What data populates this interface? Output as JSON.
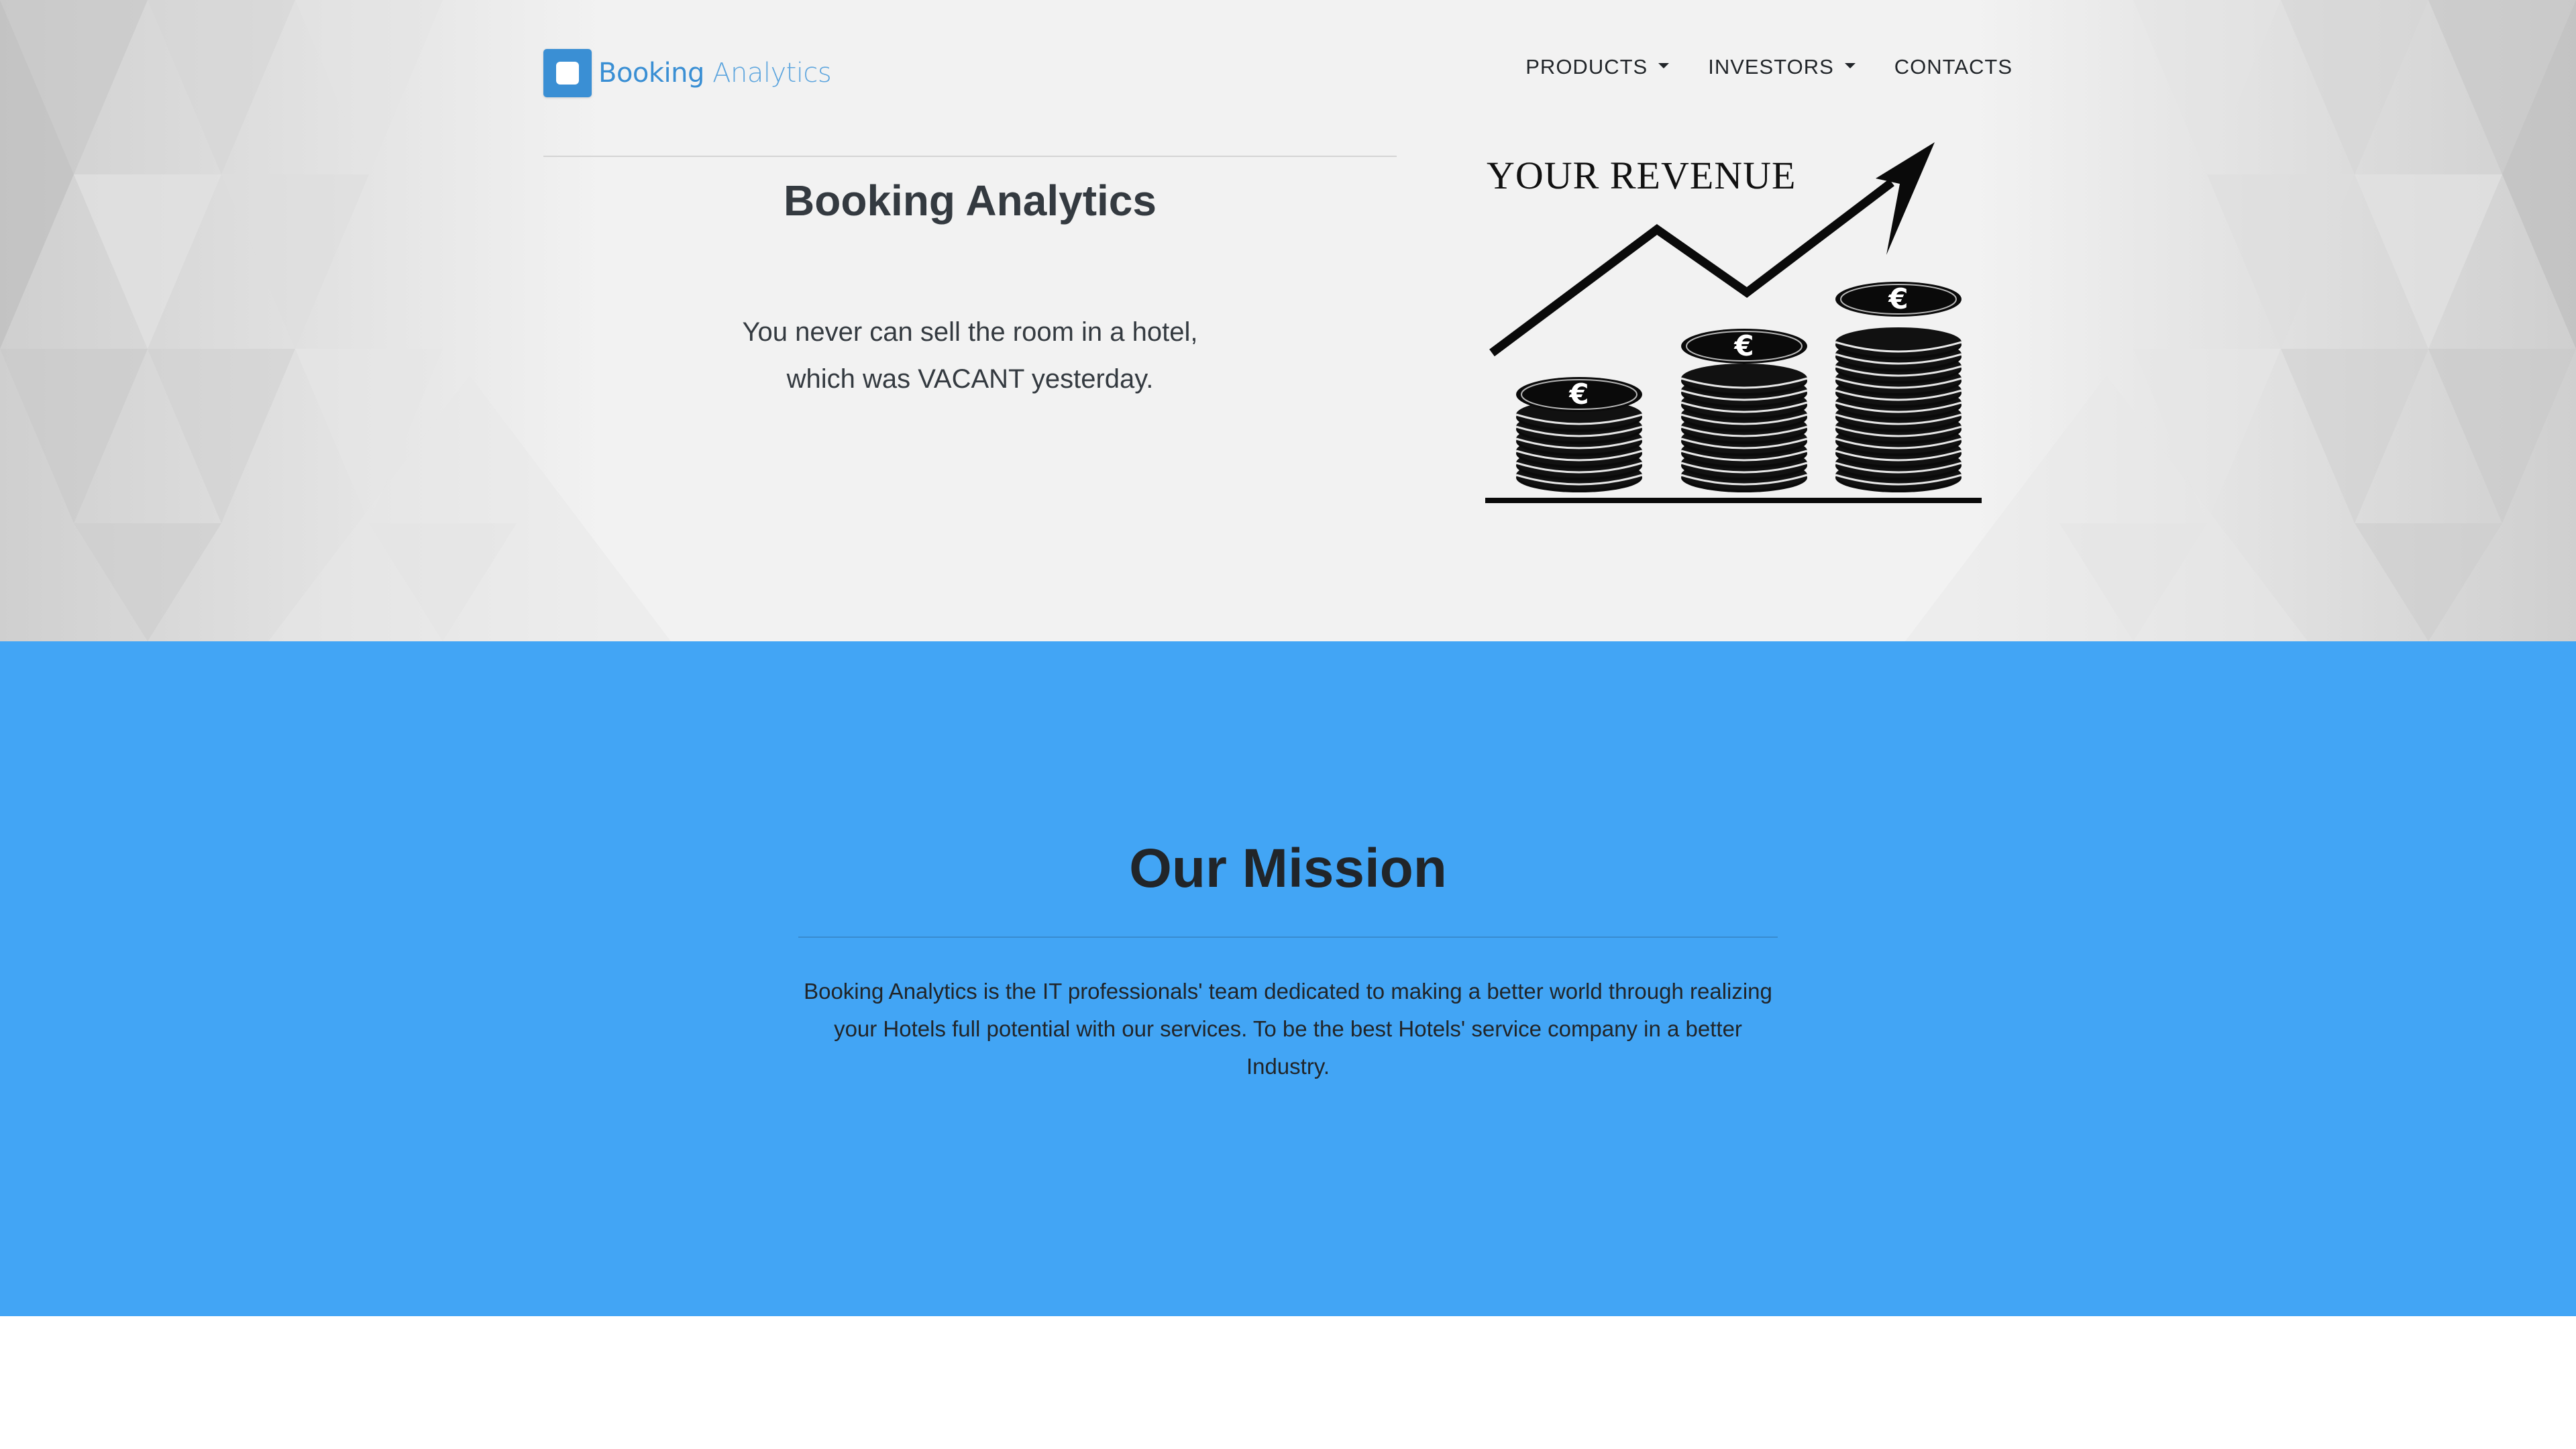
{
  "header": {
    "logo_text_primary": "Booking",
    "logo_text_secondary": "Analytics",
    "nav": [
      {
        "label": "PRODUCTS",
        "has_dropdown": true
      },
      {
        "label": "INVESTORS",
        "has_dropdown": true
      },
      {
        "label": "CONTACTS",
        "has_dropdown": false
      }
    ]
  },
  "hero": {
    "title": "Booking Analytics",
    "quote_line1": "You never can sell the room in a hotel,",
    "quote_line2": "which was VACANT yesterday.",
    "graphic_label": "YOUR REVENUE",
    "coin_symbol": "€"
  },
  "mission": {
    "title": "Our Mission",
    "text": "Booking Analytics is the IT professionals' team dedicated to making a better world through realizing your Hotels full potential with our services. To be the best Hotels' service company in a better Industry.",
    "background_color": "#42a5f5"
  },
  "colors": {
    "brand": "#3a8fd4",
    "text_dark": "#212529"
  }
}
